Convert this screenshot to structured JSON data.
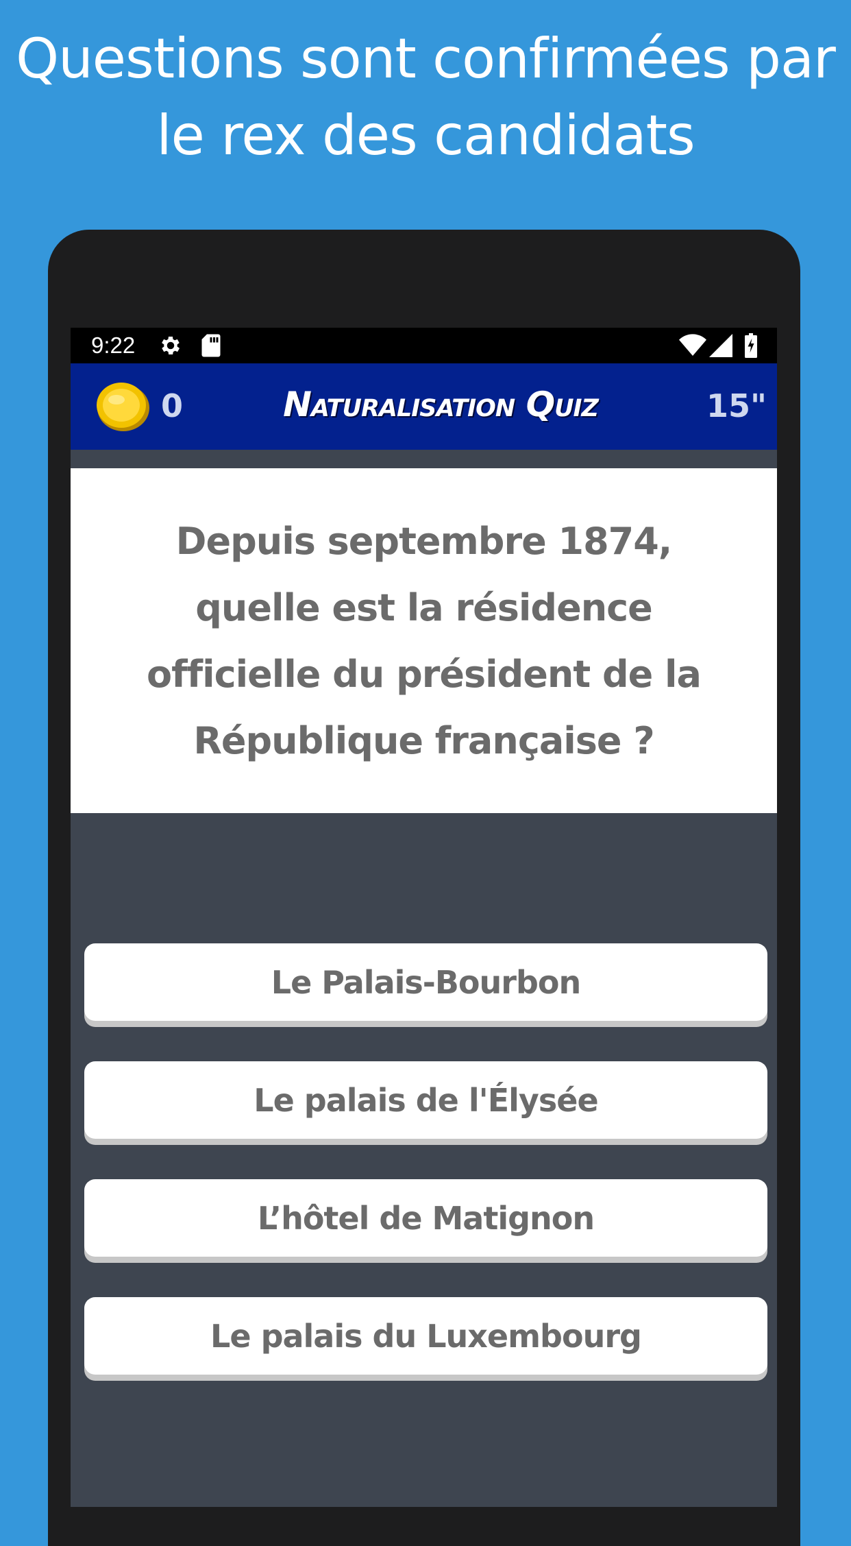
{
  "promo": {
    "title_line1": "Questions sont confirmées par",
    "title_line2": "le rex des candidats"
  },
  "status_bar": {
    "time": "9:22",
    "icons": [
      "settings-icon",
      "sd-card-icon",
      "wifi-icon",
      "signal-icon",
      "battery-charging-icon"
    ]
  },
  "app_bar": {
    "coins": "0",
    "title": "Naturalisation Quiz",
    "timer": "15\""
  },
  "question": {
    "text": "Depuis septembre 1874, quelle est la résidence officielle du président de la République française ?"
  },
  "answers": [
    {
      "label": "Le Palais-Bourbon"
    },
    {
      "label": "Le palais de l'Élysée"
    },
    {
      "label": "L’hôtel de Matignon"
    },
    {
      "label": "Le palais du Luxembourg"
    }
  ],
  "colors": {
    "background": "#3597DB",
    "app_bar": "#03218E",
    "screen": "#3e4550",
    "device": "#1d1d1e",
    "text_gray": "#6b6b6b",
    "coin": "#F2C200"
  }
}
